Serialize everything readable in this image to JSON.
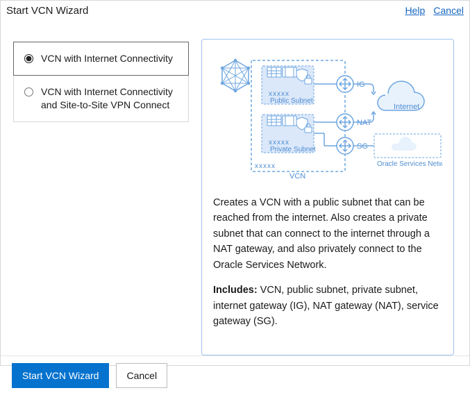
{
  "header": {
    "title": "Start VCN Wizard",
    "help": "Help",
    "cancel": "Cancel"
  },
  "options": [
    {
      "id": "opt-internet",
      "label": "VCN with Internet Connectivity",
      "selected": true
    },
    {
      "id": "opt-internet-vpn",
      "label": "VCN with Internet Connectivity and Site-to-Site VPN Connect",
      "selected": false
    }
  ],
  "diagram": {
    "public_subnet": "Public Subnet",
    "private_subnet": "Private Subnet",
    "placeholder": "xxxxx",
    "vcn": "VCN",
    "ig": "IG",
    "nat": "NAT",
    "sg": "SG",
    "internet": "Internet",
    "osn": "Oracle Services Network"
  },
  "details": {
    "description": "Creates a VCN with a public subnet that can be reached from the internet. Also creates a private subnet that can connect to the internet through a NAT gateway, and also privately connect to the Oracle Services Network.",
    "includes_label": "Includes:",
    "includes_text": " VCN, public subnet, private subnet, internet gateway (IG), NAT gateway (NAT), service gateway (SG)."
  },
  "footer": {
    "primary": "Start VCN Wizard",
    "cancel": "Cancel"
  }
}
